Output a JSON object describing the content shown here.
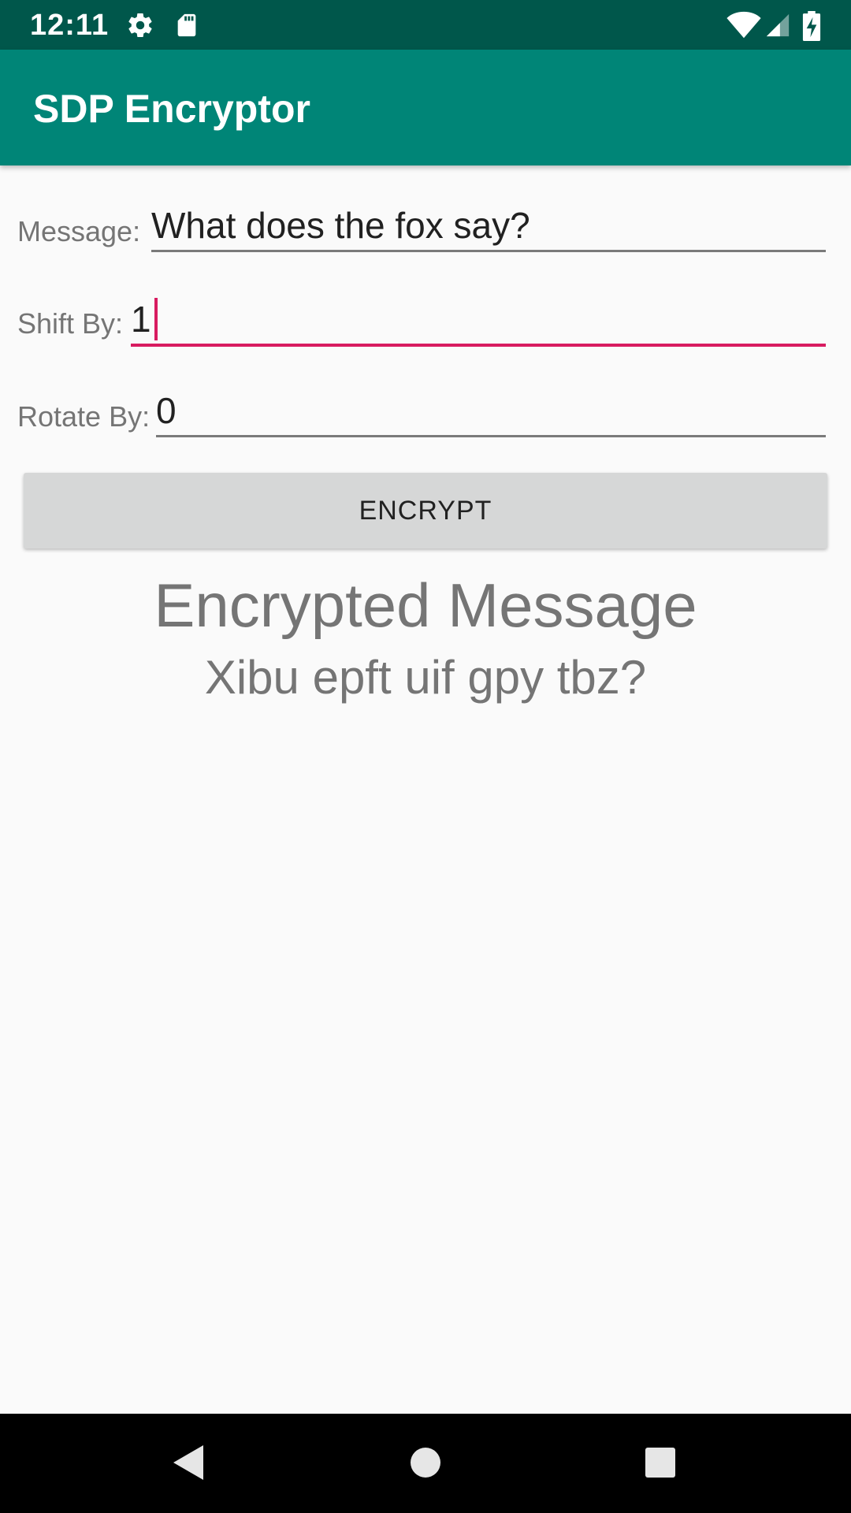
{
  "status_bar": {
    "time": "12:11",
    "icons": [
      "gear-icon",
      "sd-card-icon",
      "wifi-icon",
      "signal-icon",
      "battery-charging-icon"
    ]
  },
  "app_bar": {
    "title": "SDP Encryptor",
    "color": "#008577"
  },
  "form": {
    "message": {
      "label": "Message:",
      "value": "What does the fox say?"
    },
    "shift": {
      "label": "Shift By:",
      "value": "1"
    },
    "rotate": {
      "label": "Rotate By:",
      "value": "0"
    },
    "encrypt_label": "ENCRYPT"
  },
  "result": {
    "heading": "Encrypted Message",
    "text": "Xibu epft uif gpy tbz?"
  },
  "nav_bar": {
    "icons": [
      "back-icon",
      "home-icon",
      "recents-icon"
    ]
  },
  "colors": {
    "status_bar": "#00574b",
    "accent": "#d81b60"
  }
}
